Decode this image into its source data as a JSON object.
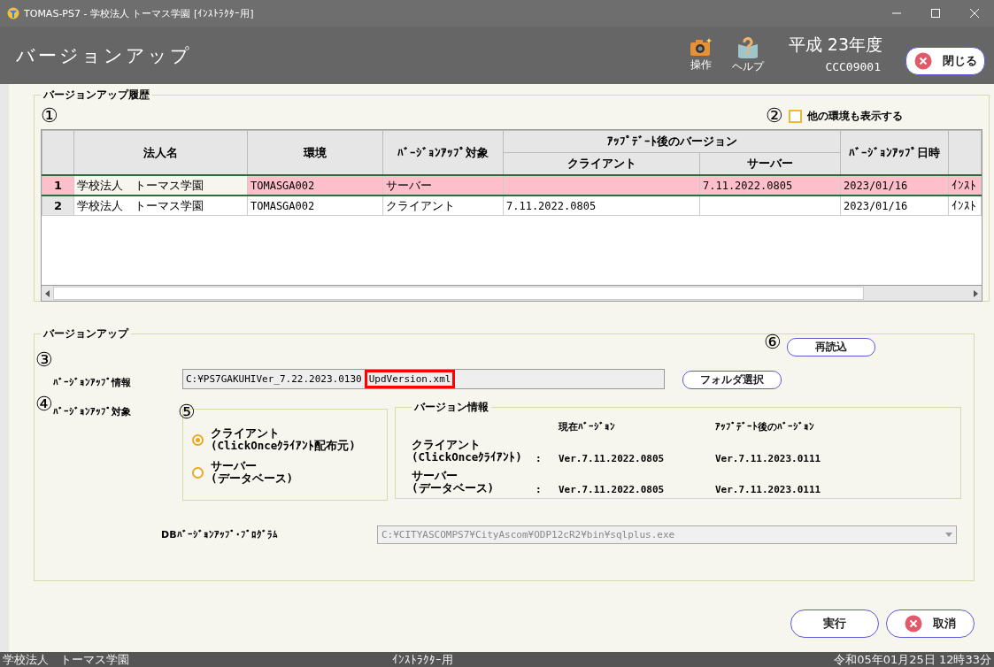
{
  "window": {
    "title": "TOMAS-PS7 - 学校法人  トーマス学園 [ｲﾝｽﾄﾗｸﾀｰ用]"
  },
  "header": {
    "title": "バージョンアップ",
    "tools": [
      {
        "label": "操作",
        "kind": "camera"
      },
      {
        "label": "ヘルプ",
        "kind": "help"
      }
    ],
    "era": "平成 23年度",
    "code": "CCC09001",
    "close_button": "閉じる"
  },
  "history": {
    "legend": "バージョンアップ履歴",
    "marker": "①",
    "show_other": {
      "marker": "②",
      "label": "他の環境も表示する",
      "checked": false
    },
    "table": {
      "columns": [
        {
          "label": "法人名"
        },
        {
          "label": "環境"
        },
        {
          "label": "ﾊﾞｰｼﾞｮﾝｱｯﾌﾟ対象"
        },
        {
          "label": "ｱｯﾌﾟﾃﾞｰﾄ後のバージョン",
          "colspan": 2,
          "children": [
            {
              "label": "クライアント"
            },
            {
              "label": "サーバー"
            }
          ]
        },
        {
          "label": "ﾊﾞｰｼﾞｮﾝｱｯﾌﾟ日時"
        }
      ],
      "rows": [
        {
          "number": "1",
          "selected": true,
          "cells": [
            "学校法人　トーマス学園",
            "TOMASGA002",
            "サーバー",
            null,
            "7.11.2022.0805",
            "2023/01/16",
            "ｲﾝｽﾄ"
          ]
        },
        {
          "number": "2",
          "selected": false,
          "cells": [
            "学校法人　トーマス学園",
            "TOMASGA002",
            "クライアント",
            "7.11.2022.0805",
            null,
            "2023/01/16",
            "ｲﾝｽﾄ"
          ]
        }
      ]
    }
  },
  "update": {
    "legend": "バージョンアップ",
    "info": {
      "marker": "③",
      "label": "ﾊﾞｰｼﾞｮﾝｱｯﾌﾟ情報",
      "path": "C:¥PS7GAKUHIVer_7.22.2023.0130",
      "file": "UpdVersion.xml",
      "file_highlighted": true
    },
    "folder_button": "フォルダ選択",
    "reload": {
      "marker": "⑥",
      "label": "再読込"
    },
    "target": {
      "marker": "④",
      "label": "ﾊﾞｰｼﾞｮﾝｱｯﾌﾟ対象",
      "options_marker": "⑤",
      "options": [
        {
          "label": "クライアント\n(ClickOnceｸﾗｲｱﾝﾄ配布元)",
          "selected": true
        },
        {
          "label": "サーバー\n(データベース)",
          "selected": false
        }
      ]
    },
    "version_info": {
      "legend": "バージョン情報",
      "headers": [
        "現在ﾊﾞｰｼﾞｮﾝ",
        "ｱｯﾌﾟﾃﾞｰﾄ後のﾊﾞｰｼﾞｮﾝ"
      ],
      "rows": [
        {
          "label": "クライアント\n(ClickOnceｸﾗｲｱﾝﾄ)",
          "separator": ":",
          "current": "Ver.7.11.2022.0805",
          "after": "Ver.7.11.2023.0111"
        },
        {
          "label": "サーバー\n(データベース)",
          "separator": ":",
          "current": "Ver.7.11.2022.0805",
          "after": "Ver.7.11.2023.0111"
        }
      ]
    },
    "db_program": {
      "label": "DBﾊﾞｰｼﾞｮﾝｱｯﾌﾟ･ﾌﾟﾛｸﾞﾗﾑ",
      "value": "C:¥CITYASCOMPS7¥CityAscom¥ODP12cR2¥bin¥sqlplus.exe",
      "disabled": true
    }
  },
  "actions": [
    {
      "label": "実行",
      "kind": "plain"
    },
    {
      "label": "取消",
      "kind": "cancel"
    }
  ],
  "status_bar": {
    "left": "学校法人　トーマス学園",
    "center": "ｲﾝｽﾄﾗｸﾀｰ用",
    "right": "令和05年01月25日 12時33分"
  }
}
